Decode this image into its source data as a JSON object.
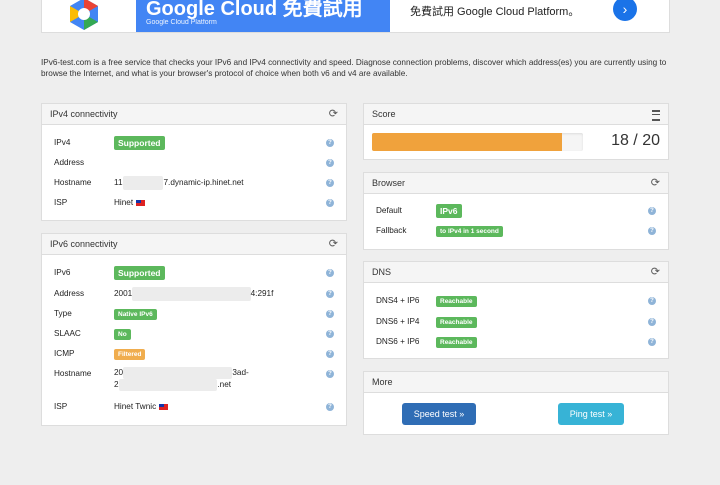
{
  "ad": {
    "banner_title": "Google Cloud 免費試用",
    "banner_sub": "Google Cloud Platform",
    "text": "免費試用 Google Cloud Platform。",
    "arrow": "›"
  },
  "intro": "IPv6-test.com is a free service that checks your IPv6 and IPv4 connectivity and speed. Diagnose connection problems, discover which address(es) you are currently using to browse the Internet, and what is your browser's protocol of choice when both v6 and v4 are available.",
  "ipv4": {
    "title": "IPv4 connectivity",
    "rows": [
      {
        "label": "IPv4",
        "badge": "Supported"
      },
      {
        "label": "Address",
        "value": ""
      },
      {
        "label": "Hostname",
        "value_prefix": "11",
        "value": "7.dynamic-ip.hinet.net"
      },
      {
        "label": "ISP",
        "value": "Hinet"
      }
    ]
  },
  "ipv6": {
    "title": "IPv6 connectivity",
    "rows": [
      {
        "label": "IPv6",
        "badge": "Supported"
      },
      {
        "label": "Address",
        "value_start": "2001",
        "value_end": "4:291f"
      },
      {
        "label": "Type",
        "badge": "Native IPv6"
      },
      {
        "label": "SLAAC",
        "badge": "No"
      },
      {
        "label": "ICMP",
        "badge": "Filtered"
      },
      {
        "label": "Hostname",
        "value_line1_start": "20",
        "value_line1_end": "3ad-",
        "value_line2_start": "2",
        "value_line2_end": ".net"
      },
      {
        "label": "ISP",
        "value": "Hinet Twnic"
      }
    ]
  },
  "score": {
    "title": "Score",
    "value": "18 / 20",
    "fraction": 0.9
  },
  "browser": {
    "title": "Browser",
    "rows": [
      {
        "label": "Default",
        "badge": "IPv6"
      },
      {
        "label": "Fallback",
        "badge": "to IPv4 in 1 second"
      }
    ]
  },
  "dns": {
    "title": "DNS",
    "rows": [
      {
        "label": "DNS4 + IP6",
        "badge": "Reachable"
      },
      {
        "label": "DNS6 + IP4",
        "badge": "Reachable"
      },
      {
        "label": "DNS6 + IP6",
        "badge": "Reachable"
      }
    ]
  },
  "more": {
    "title": "More",
    "speed_button": "Speed test »",
    "ping_button": "Ping test »"
  },
  "colors": {
    "success": "#5cb85c",
    "warning": "#f0ad4e",
    "primary": "#2f6db5",
    "info": "#37b3d6",
    "progress": "#f0a23c"
  },
  "icons": {
    "refresh": "refresh-icon",
    "help": "help-icon",
    "list": "list-icon",
    "flag": "taiwan-flag-icon"
  }
}
